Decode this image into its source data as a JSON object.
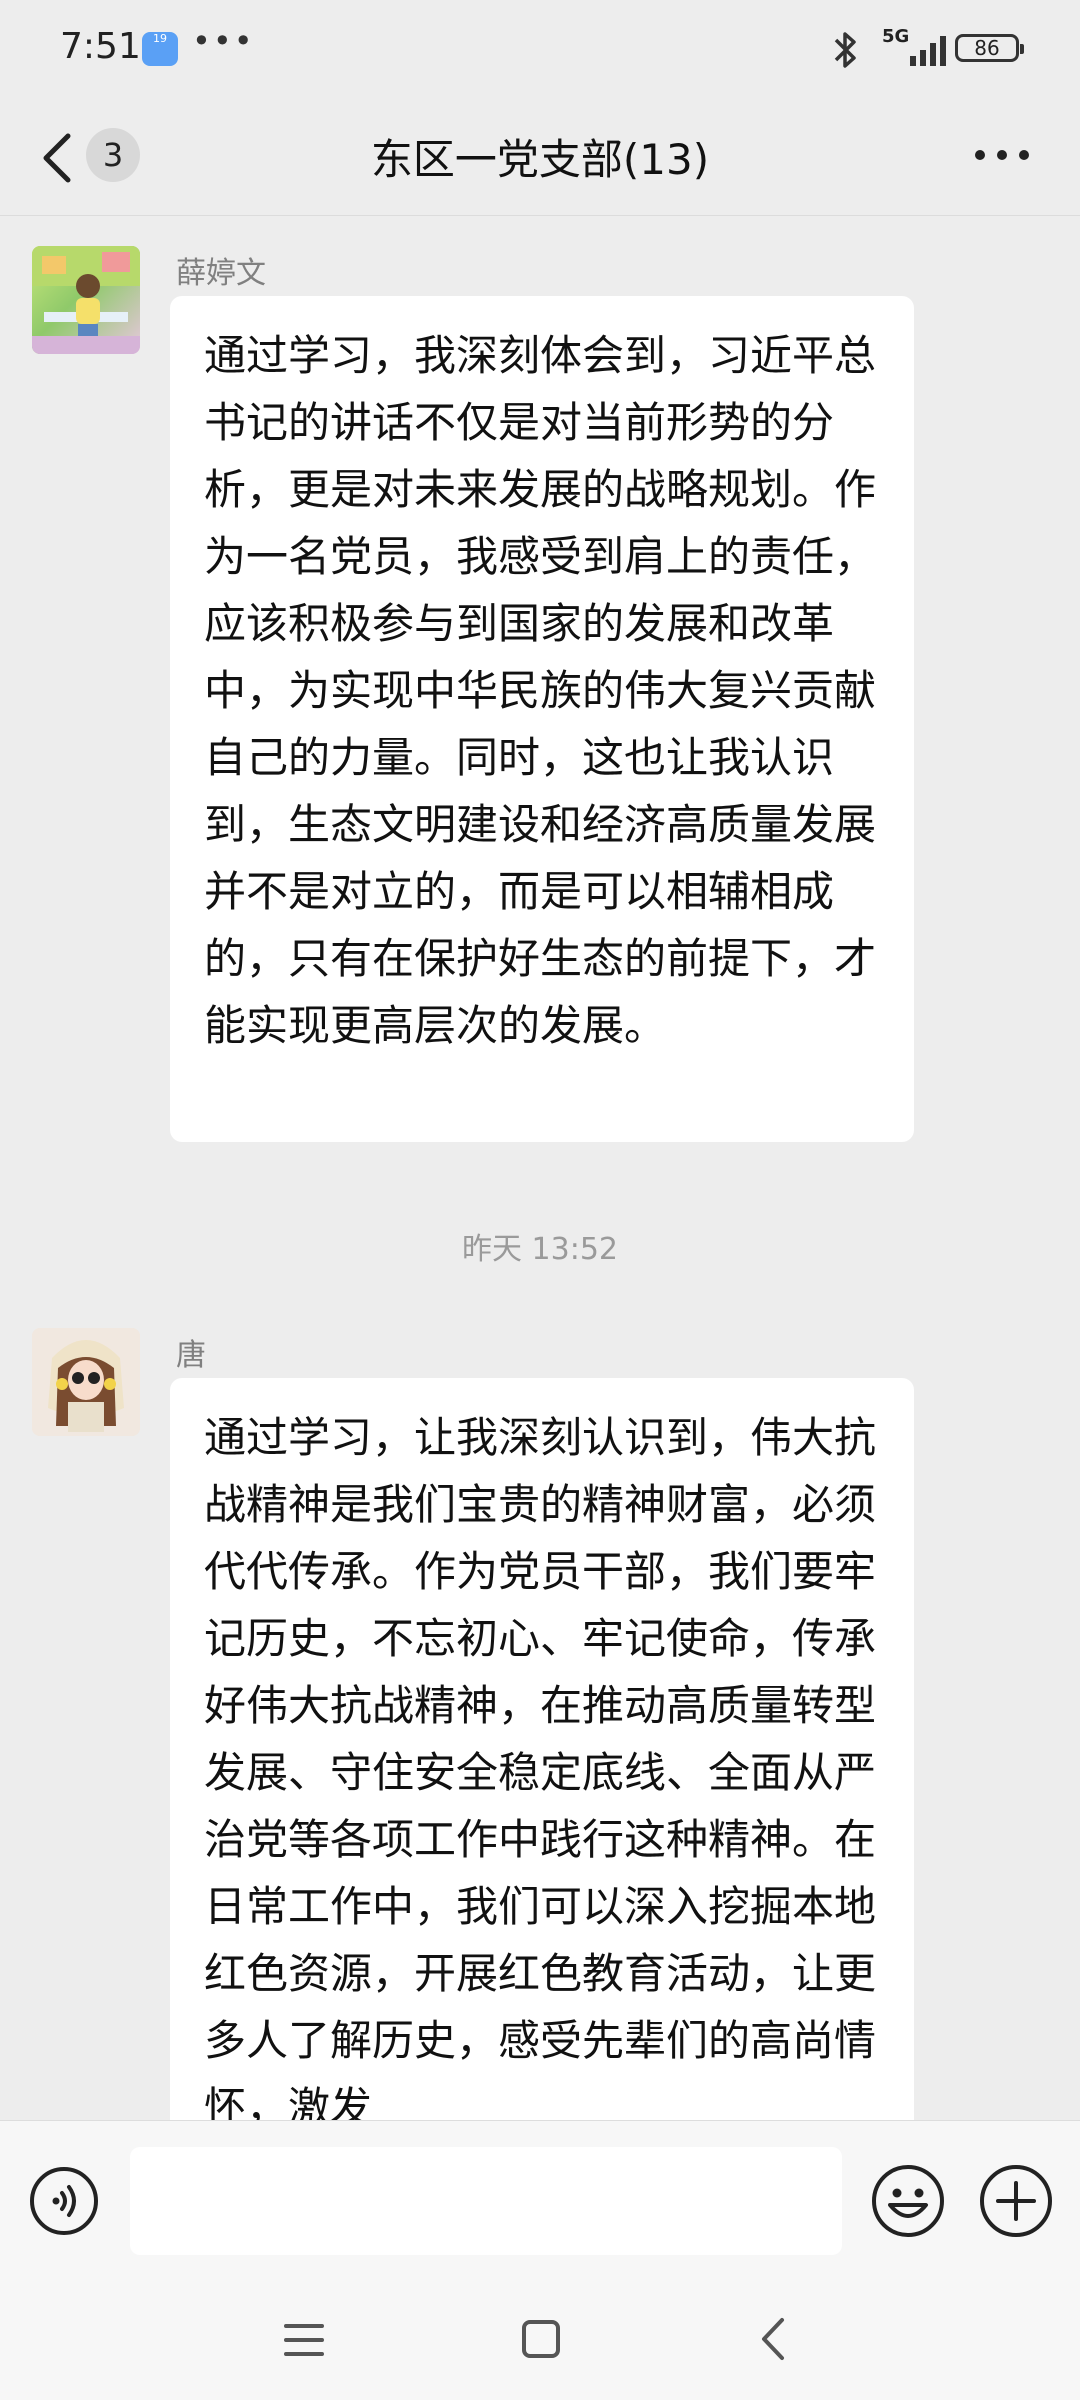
{
  "status_bar": {
    "time": "7:51",
    "weather_badge": "19",
    "network": "5G",
    "battery": "86"
  },
  "header": {
    "unread_count": "3",
    "title": "东区一党支部(13)"
  },
  "messages": [
    {
      "sender": "薛婷文",
      "text": "通过学习，我深刻体会到，习近平总书记的讲话不仅是对当前形势的分析，更是对未来发展的战略规划。作为一名党员，我感受到肩上的责任，应该积极参与到国家的发展和改革中，为实现中华民族的伟大复兴贡献自己的力量。同时，这也让我认识到，生态文明建设和经济高质量发展并不是对立的，而是可以相辅相成的，只有在保护好生态的前提下，才能实现更高层次的发展。"
    },
    {
      "sender": "唐",
      "text": "通过学习，让我深刻认识到，伟大抗战精神是我们宝贵的精神财富，必须代代传承。作为党员干部，我们要牢记历史，不忘初心、牢记使命，传承好伟大抗战精神，在推动高质量转型发展、守住安全稳定底线、全面从严治党等各项工作中践行这种精神。在日常工作中，我们可以深入挖掘本地红色资源，开展红色教育活动，让更多人了解历史，感受先辈们的高尚情怀，激发"
    }
  ],
  "timestamp": "昨天 13:52",
  "input": {
    "value": "",
    "placeholder": ""
  },
  "colors": {
    "background": "#ededed",
    "bubble": "#ffffff",
    "bar": "#f7f7f7"
  }
}
